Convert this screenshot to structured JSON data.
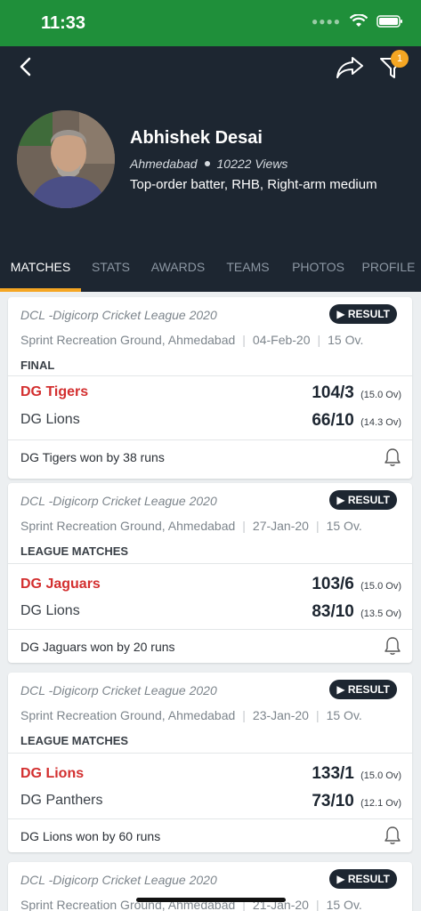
{
  "status": {
    "time": "11:33"
  },
  "header": {
    "player_name": "Abhishek Desai",
    "city": "Ahmedabad",
    "views": "10222 Views",
    "role": "Top-order batter, RHB, Right-arm medium",
    "filter_badge": "1"
  },
  "tabs": [
    "MATCHES",
    "STATS",
    "AWARDS",
    "TEAMS",
    "PHOTOS",
    "PROFILE"
  ],
  "colors": {
    "header_bg": "#1d2631",
    "status_bg": "#1f8f3a",
    "accent": "#f5a623",
    "winner": "#d32f2f"
  },
  "matches": [
    {
      "league": "DCL -Digicorp Cricket League 2020",
      "result_label": "RESULT",
      "venue": "Sprint Recreation Ground, Ahmedabad",
      "date": "04-Feb-20",
      "overs": "15 Ov.",
      "stage": "FINAL",
      "team1": {
        "name": "DG Tigers",
        "score": "104/3",
        "overs": "(15.0 Ov)"
      },
      "team2": {
        "name": "DG Lions",
        "score": "66/10",
        "overs": "(14.3 Ov)"
      },
      "summary": "DG Tigers won by 38 runs"
    },
    {
      "league": "DCL -Digicorp Cricket League 2020",
      "result_label": "RESULT",
      "venue": "Sprint Recreation Ground, Ahmedabad",
      "date": "27-Jan-20",
      "overs": "15 Ov.",
      "stage": "LEAGUE MATCHES",
      "team1": {
        "name": "DG Jaguars",
        "score": "103/6",
        "overs": "(15.0 Ov)"
      },
      "team2": {
        "name": "DG Lions",
        "score": "83/10",
        "overs": "(13.5 Ov)"
      },
      "summary": "DG Jaguars won by 20 runs"
    },
    {
      "league": "DCL -Digicorp Cricket League 2020",
      "result_label": "RESULT",
      "venue": "Sprint Recreation Ground, Ahmedabad",
      "date": "23-Jan-20",
      "overs": "15 Ov.",
      "stage": "LEAGUE MATCHES",
      "team1": {
        "name": "DG Lions",
        "score": "133/1",
        "overs": "(15.0 Ov)"
      },
      "team2": {
        "name": "DG Panthers",
        "score": "73/10",
        "overs": "(12.1 Ov)"
      },
      "summary": "DG Lions won by 60 runs"
    },
    {
      "league": "DCL -Digicorp Cricket League 2020",
      "result_label": "RESULT",
      "venue": "Sprint Recreation Ground, Ahmedabad",
      "date": "21-Jan-20",
      "overs": "15 Ov."
    }
  ]
}
